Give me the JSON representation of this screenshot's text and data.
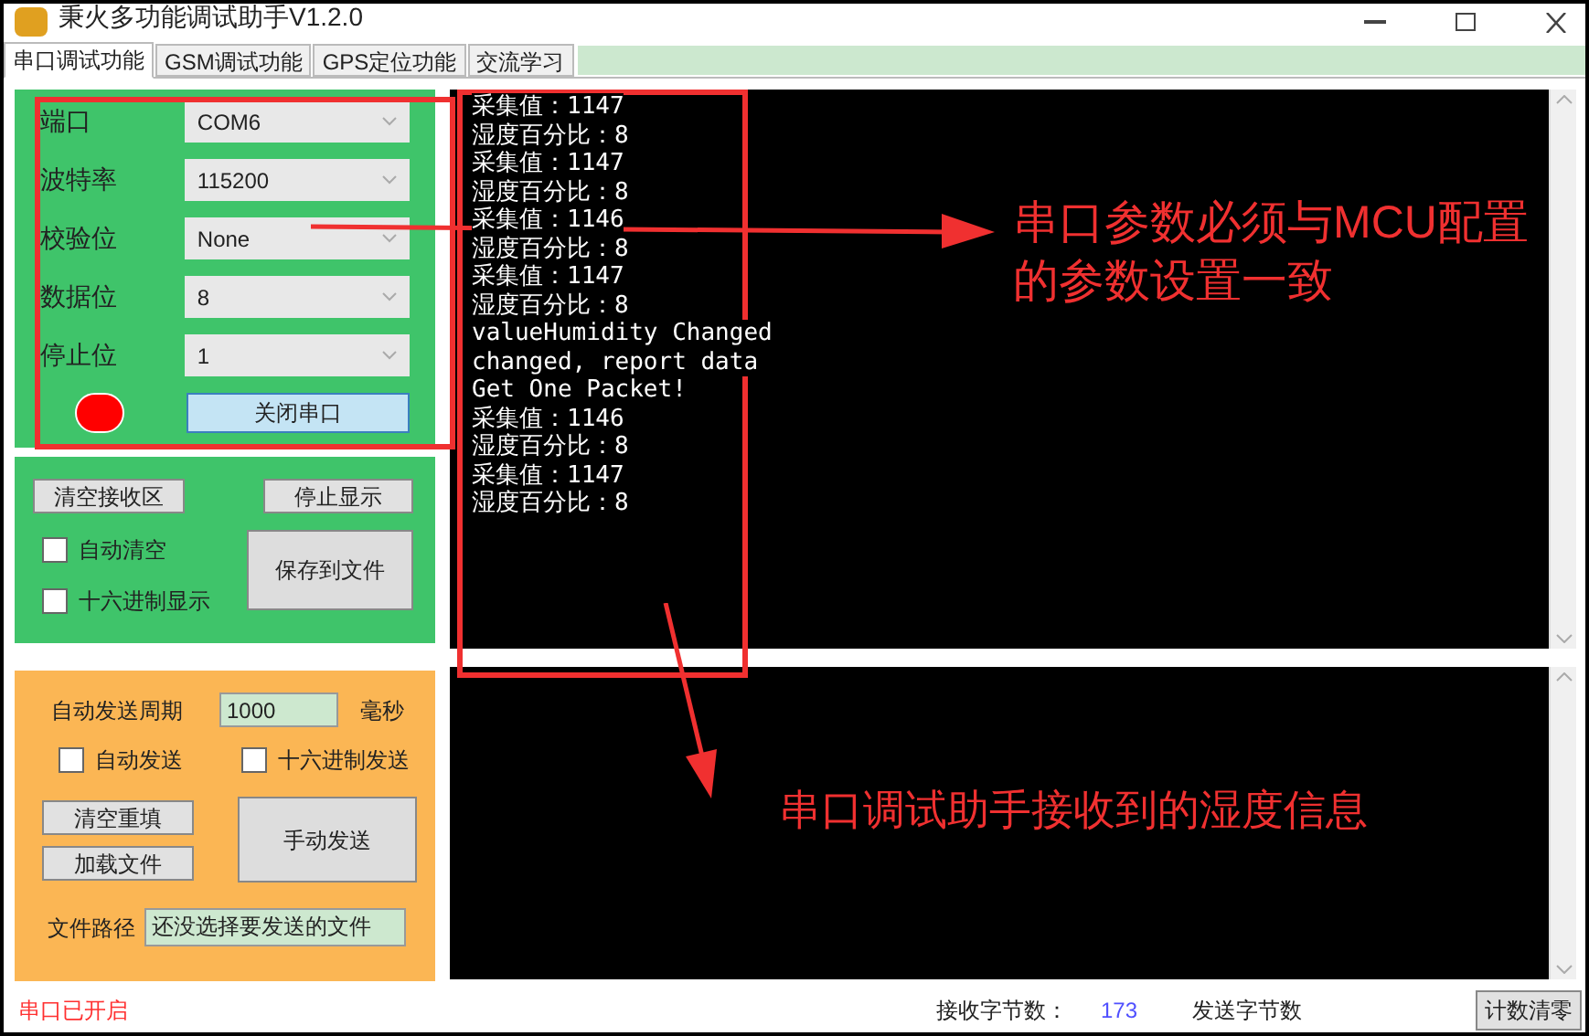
{
  "window": {
    "title": "秉火多功能调试助手V1.2.0"
  },
  "tabs": [
    {
      "label": "串口调试功能",
      "selected": true
    },
    {
      "label": "GSM调试功能",
      "selected": false
    },
    {
      "label": "GPS定位功能",
      "selected": false
    },
    {
      "label": "交流学习",
      "selected": false
    }
  ],
  "serial_settings": {
    "fields": [
      {
        "label": "端口",
        "value": "COM6"
      },
      {
        "label": "波特率",
        "value": "115200"
      },
      {
        "label": "校验位",
        "value": "None"
      },
      {
        "label": "数据位",
        "value": "8"
      },
      {
        "label": "停止位",
        "value": "1"
      }
    ],
    "status_led": {
      "on": true
    },
    "toggle_button": "关闭串口"
  },
  "receive_controls": {
    "clear_button": "清空接收区",
    "stop_button": "停止显示",
    "options": [
      {
        "label": "自动清空",
        "checked": false
      },
      {
        "label": "十六进制显示",
        "checked": false
      }
    ],
    "save_button": "保存到文件"
  },
  "send_controls": {
    "period_label": "自动发送周期",
    "period_value": "1000",
    "period_unit": "毫秒",
    "options": [
      {
        "label": "自动发送",
        "checked": false
      },
      {
        "label": "十六进制发送",
        "checked": false
      }
    ],
    "clear_button": "清空重填",
    "load_button": "加载文件",
    "send_button": "手动发送",
    "file_path_label": "文件路径",
    "file_path_value": "还没选择要发送的文件"
  },
  "status": "串口已开启",
  "receive_log": [
    "采集值：1147",
    "湿度百分比：8",
    "采集值：1147",
    "湿度百分比：8",
    "采集值：1146",
    "湿度百分比：8",
    "采集值：1147",
    "湿度百分比：8",
    "valueHumidity Changed",
    "changed, report data",
    "Get One Packet!",
    "采集值：1146",
    "湿度百分比：8",
    "采集值：1147",
    "湿度百分比：8"
  ],
  "counters": {
    "received_label": "接收字节数：",
    "received_value": "173",
    "sent_label": "发送字节数",
    "reset_button": "计数清零"
  },
  "annotations": [
    {
      "text": "串口参数必须与MCU配置的参数设置一致"
    },
    {
      "text": "串口调试助手接收到的湿度信息"
    }
  ]
}
